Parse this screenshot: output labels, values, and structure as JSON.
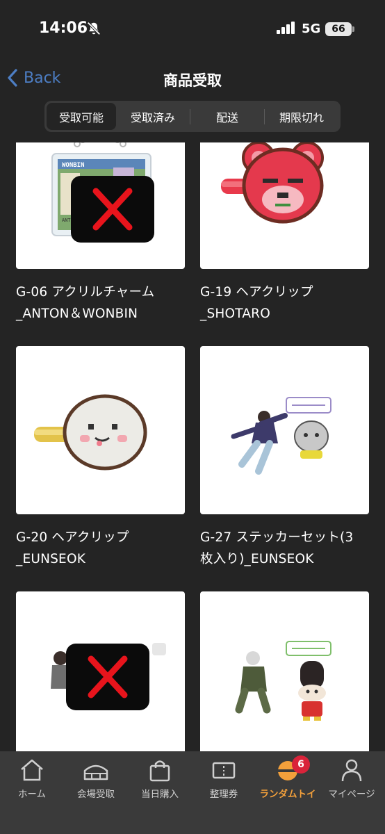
{
  "status_bar": {
    "time": "14:06",
    "network": "5G",
    "battery": "66"
  },
  "nav": {
    "back_label": "Back",
    "title": "商品受取"
  },
  "tabs": [
    {
      "label": "受取可能",
      "active": true
    },
    {
      "label": "受取済み",
      "active": false
    },
    {
      "label": "配送",
      "active": false
    },
    {
      "label": "期限切れ",
      "active": false
    }
  ],
  "products": [
    {
      "line1": "G-06 アクリルチャーム",
      "line2": "_ANTON＆WONBIN",
      "thumb_text": "WONBIN",
      "thumb_small": "ANTON",
      "covered": true
    },
    {
      "line1": "G-19 ヘアクリップ",
      "line2": "_SHOTARO",
      "covered": false
    },
    {
      "line1": "G-20 ヘアクリップ",
      "line2": "_EUNSEOK",
      "covered": false
    },
    {
      "line1": "G-27 ステッカーセット(3",
      "line2": "枚入り)_EUNSEOK",
      "covered": false
    },
    {
      "line1": "",
      "line2": "",
      "covered": true
    },
    {
      "line1": "",
      "line2": "",
      "covered": false
    }
  ],
  "bottom_nav": [
    {
      "label": "ホーム",
      "icon": "home-icon",
      "active": false
    },
    {
      "label": "会場受取",
      "icon": "venue-icon",
      "active": false
    },
    {
      "label": "当日購入",
      "icon": "shopping-bag-icon",
      "active": false
    },
    {
      "label": "整理券",
      "icon": "ticket-icon",
      "active": false
    },
    {
      "label": "ランダムトイ",
      "icon": "random-toy-icon",
      "active": true,
      "badge": "6"
    },
    {
      "label": "マイページ",
      "icon": "person-icon",
      "active": false
    }
  ],
  "colors": {
    "background": "#242424",
    "accent": "#f3a03b",
    "link": "#4d7ec4",
    "badge": "#d9233a",
    "cross": "#e8141c"
  }
}
